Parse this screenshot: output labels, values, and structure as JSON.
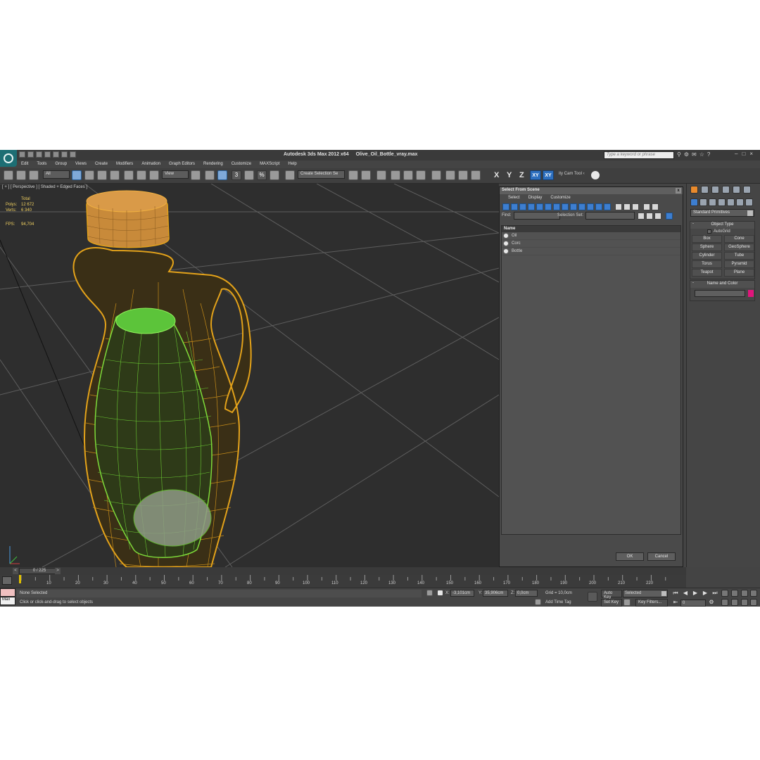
{
  "app": {
    "title": "Autodesk 3ds Max  2012 x64",
    "file": "Olive_Oil_Bottle_vray.max",
    "search_placeholder": "Type a keyword or phrase"
  },
  "menu": [
    "Edit",
    "Tools",
    "Group",
    "Views",
    "Create",
    "Modifiers",
    "Animation",
    "Graph Editors",
    "Rendering",
    "Customize",
    "MAXScript",
    "Help"
  ],
  "toolbar": {
    "filter_value": "All",
    "refcoord_value": "View",
    "selection_set_value": "Create Selection Se",
    "snap_numbers": [
      "3",
      "%"
    ],
    "axes": [
      "X",
      "Y",
      "Z",
      "XY",
      "XY"
    ],
    "cam_tool": "ity Cam Tool ‹"
  },
  "viewport": {
    "label": "[ + ] [ Perspective ] [ Shaded + Edged Faces ]",
    "stats_header": "Total",
    "polys_label": "Polys:",
    "polys_value": "12 672",
    "verts_label": "Verts:",
    "verts_value": "6 340",
    "fps_label": "FPS:",
    "fps_value": "94,704"
  },
  "dialog": {
    "title": "Select From Scene",
    "close": "x",
    "menus": [
      "Select",
      "Display",
      "Customize"
    ],
    "find_label": "Find:",
    "selection_set_label": "Selection Set:",
    "column_name": "Name",
    "items": [
      "Oil",
      "Corc",
      "Bottle"
    ],
    "ok": "OK",
    "cancel": "Cancel"
  },
  "command_panel": {
    "dropdown": "Standard Primitives",
    "object_type_title": "Object Type",
    "autogrid": "AutoGrid",
    "buttons": [
      "Box",
      "Cone",
      "Sphere",
      "GeoSphere",
      "Cylinder",
      "Tube",
      "Torus",
      "Pyramid",
      "Teapot",
      "Plane"
    ],
    "name_color_title": "Name and Color",
    "swatch_color": "#e0157c"
  },
  "timeline": {
    "frame_display": "0 / 225",
    "prev": "<",
    "next": ">",
    "ticks": [
      "10",
      "20",
      "30",
      "40",
      "50",
      "60",
      "70",
      "80",
      "90",
      "100",
      "110",
      "120",
      "130",
      "140",
      "150",
      "160",
      "170",
      "180",
      "190",
      "200",
      "210",
      "220"
    ]
  },
  "status": {
    "selection": "None Selected",
    "prompt": "Click or click-and-drag to select objects",
    "x_label": "X:",
    "x_value": "-3,101cm",
    "y_label": "Y:",
    "y_value": "35,906cm",
    "z_label": "Z:",
    "z_value": "0,0cm",
    "grid": "Grid = 10,0cm",
    "add_time_tag": "Add Time Tag",
    "auto_key": "Auto Key",
    "set_key": "Set Key",
    "key_mode_value": "Selected",
    "key_filters": "Key Filters...",
    "current_frame": "0",
    "max_listener": "Max"
  }
}
